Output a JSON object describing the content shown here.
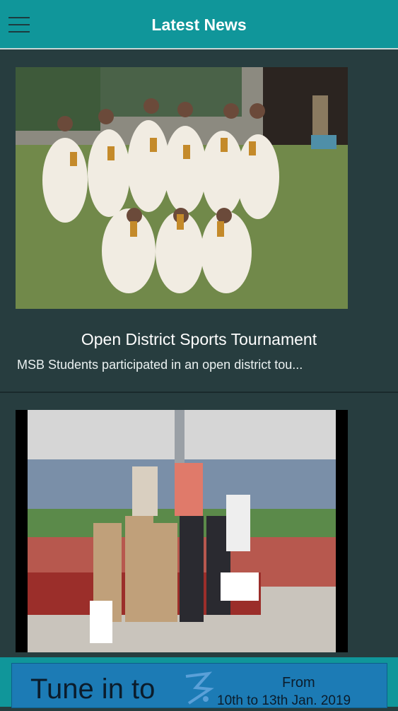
{
  "appbar": {
    "title": "Latest News"
  },
  "news": [
    {
      "title": "Open District Sports Tournament",
      "description": "MSB Students participated in an open district tou..."
    },
    {
      "title": "",
      "description": ""
    }
  ],
  "banner": {
    "tune_text": "Tune in to",
    "from_text": "From",
    "dates_text": "10th to 13th Jan. 2019"
  },
  "icons": {
    "menu": "menu-icon",
    "logo": "event-logo"
  },
  "colors": {
    "accent": "#10969a",
    "background": "#273d3f",
    "banner": "#1c7bb5"
  }
}
